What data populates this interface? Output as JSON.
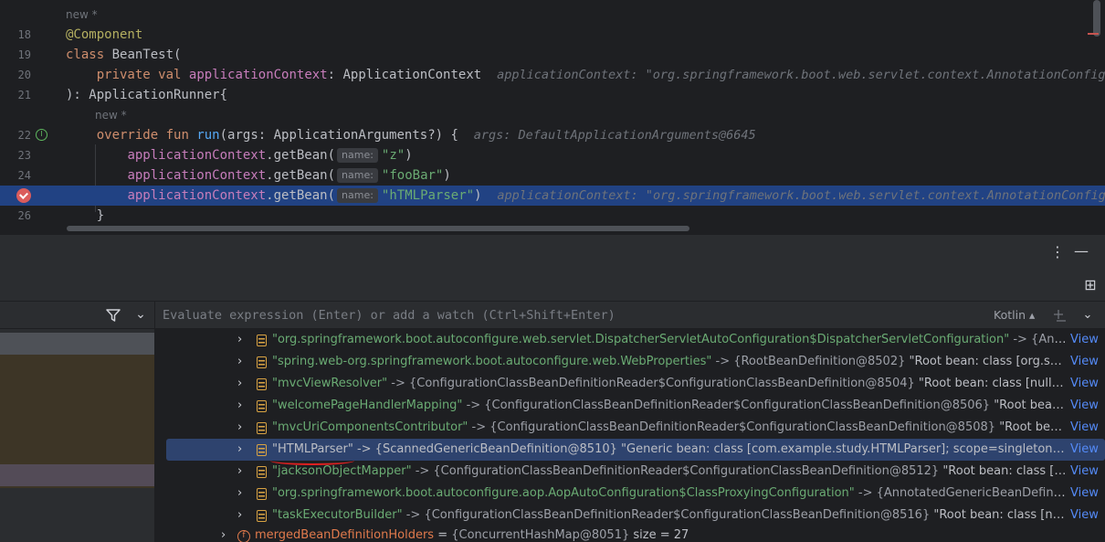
{
  "editor": {
    "hint_new_1": "new *",
    "hint_new_2": "new *",
    "lines": [
      {
        "num": "18",
        "annotation": "@Component"
      },
      {
        "num": "19",
        "kw": "class",
        "name": "BeanTest("
      },
      {
        "num": "20",
        "kw1": "private",
        "kw2": "val",
        "prop": "applicationContext",
        "type": ": ApplicationContext",
        "inlay": "applicationContext: \"org.springframework.boot.web.servlet.context.AnnotationConfigSer"
      },
      {
        "num": "21",
        "text": "): ApplicationRunner{"
      },
      {
        "num": "22",
        "kw1": "override",
        "kw2": "fun",
        "fn": "run",
        "params": "(args: ApplicationArguments?) {",
        "inlay": "args: DefaultApplicationArguments@6645"
      },
      {
        "num": "23",
        "call": "applicationContext",
        "method": ".getBean(",
        "param_name": "name:",
        "arg": "\"z\"",
        "close": ")"
      },
      {
        "num": "24",
        "call": "applicationContext",
        "method": ".getBean(",
        "param_name": "name:",
        "arg": "\"fooBar\"",
        "close": ")"
      },
      {
        "num": "",
        "call": "applicationContext",
        "method": ".getBean(",
        "param_name": "name:",
        "arg": "\"hTMLParser\"",
        "close": ")",
        "inlay": "applicationContext: \"org.springframework.boot.web.servlet.context.AnnotationConfigSer"
      },
      {
        "num": "26",
        "text": "}"
      }
    ]
  },
  "toolbar": {
    "more_icon": "⋮",
    "minimize_icon": "—",
    "layout_icon": "⊞"
  },
  "frames": {
    "filter_icon": "filter-icon",
    "chevron": "⌄"
  },
  "variables": {
    "eval_placeholder": "Evaluate expression (Enter) or add a watch (Ctrl+Shift+Enter)",
    "language": "Kotlin ▴",
    "rows": [
      {
        "key": "\"org.springframework.boot.autoconfigure.web.servlet.DispatcherServletAutoConfiguration$DispatcherServletConfiguration\"",
        "val": "-> {Annotat",
        "desc": "",
        "view": "View"
      },
      {
        "key": "\"spring.web-org.springframework.boot.autoconfigure.web.WebProperties\"",
        "val": "-> {RootBeanDefinition@8502}",
        "desc": "\"Root bean: class [org.springf",
        "view": "View"
      },
      {
        "key": "\"mvcViewResolver\"",
        "val": "-> {ConfigurationClassBeanDefinitionReader$ConfigurationClassBeanDefinition@8504}",
        "desc": "\"Root bean: class [null]; scope",
        "view": "View"
      },
      {
        "key": "\"welcomePageHandlerMapping\"",
        "val": "-> {ConfigurationClassBeanDefinitionReader$ConfigurationClassBeanDefinition@8506}",
        "desc": "\"Root bean: class",
        "view": "View"
      },
      {
        "key": "\"mvcUriComponentsContributor\"",
        "val": "-> {ConfigurationClassBeanDefinitionReader$ConfigurationClassBeanDefinition@8508}",
        "desc": "\"Root bean: clas",
        "view": "View"
      },
      {
        "key": "\"HTMLParser\"",
        "val": "-> {ScannedGenericBeanDefinition@8510}",
        "desc": "\"Generic bean: class [com.example.study.HTMLParser]; scope=singleton; abstr",
        "view": "View"
      },
      {
        "key": "\"jacksonObjectMapper\"",
        "val": "-> {ConfigurationClassBeanDefinitionReader$ConfigurationClassBeanDefinition@8512}",
        "desc": "\"Root bean: class [null]; sc",
        "view": "View"
      },
      {
        "key": "\"org.springframework.boot.autoconfigure.aop.AopAutoConfiguration$ClassProxyingConfiguration\"",
        "val": "-> {AnnotatedGenericBeanDefinition(",
        "desc": "",
        "view": "View"
      },
      {
        "key": "\"taskExecutorBuilder\"",
        "val": "-> {ConfigurationClassBeanDefinitionReader$ConfigurationClassBeanDefinition@8516}",
        "desc": "\"Root bean: class [null]; scc",
        "view": "View"
      }
    ],
    "merged": {
      "icon": "f",
      "name": "mergedBeanDefinitionHolders",
      "eq": "=",
      "val": "{ConcurrentHashMap@8051}",
      "size": "size = 27"
    }
  }
}
